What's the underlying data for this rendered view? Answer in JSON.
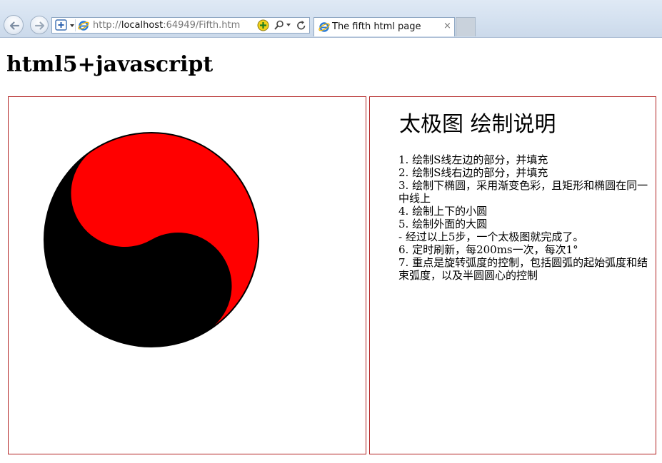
{
  "browser": {
    "url_prefix": "http://",
    "url_host": "localhost",
    "url_rest": ":64949/Fifth.htm",
    "tab_title": "The fifth html page",
    "tab_close": "×"
  },
  "page": {
    "heading": "html5+javascript"
  },
  "taiji": {
    "yin_color": "#000000",
    "yang_color": "#ff0000"
  },
  "info": {
    "title": "太极图 绘制说明",
    "items": [
      "1. 绘制S线左边的部分，并填充",
      "2. 绘制S线右边的部分，并填充",
      "3. 绘制下椭圆，采用渐变色彩，且矩形和椭圆在同一中线上",
      "4. 绘制上下的小圆",
      "5. 绘制外面的大圆",
      "- 经过以上5步，一个太极图就完成了。",
      "6. 定时刷新，每200ms一次，每次1°",
      "7. 重点是旋转弧度的控制，包括圆弧的起始弧度和结束弧度，以及半圆圆心的控制"
    ]
  }
}
